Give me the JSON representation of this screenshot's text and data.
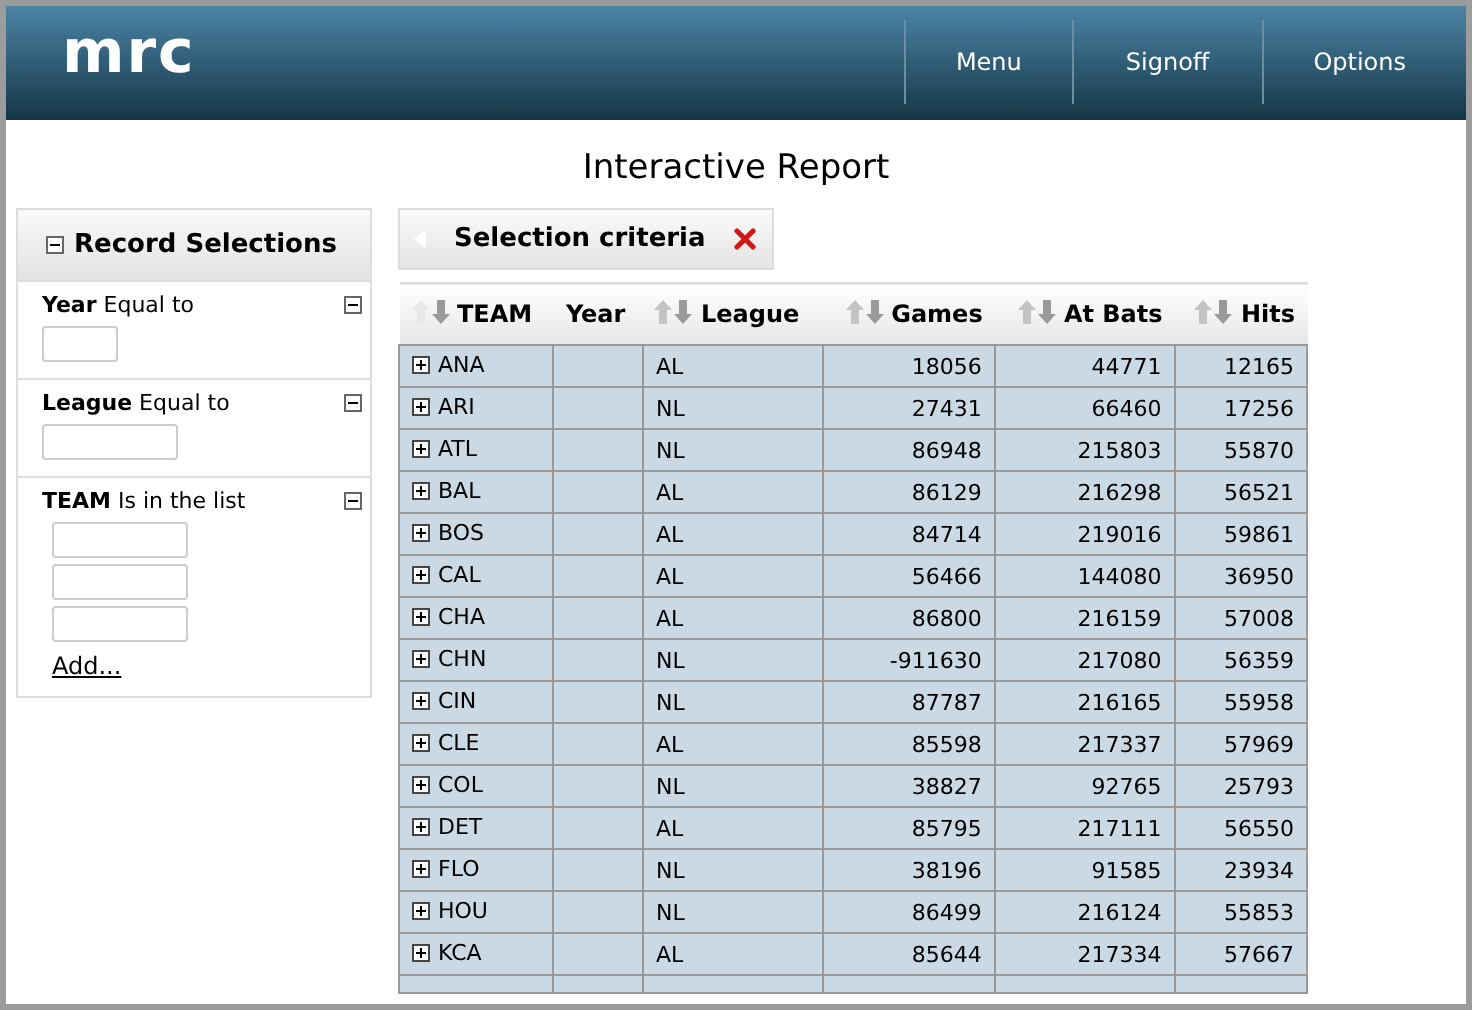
{
  "header": {
    "logo": "mrc",
    "nav": [
      "Menu",
      "Signoff",
      "Options"
    ]
  },
  "page_title": "Interactive Report",
  "sidebar": {
    "title": "Record Selections",
    "filters": [
      {
        "kind": "single",
        "field": "Year",
        "operator": "Equal to"
      },
      {
        "kind": "single",
        "field": "League",
        "operator": "Equal to"
      },
      {
        "kind": "list",
        "field": "TEAM",
        "operator": "Is in the list",
        "add_link": "Add..."
      }
    ]
  },
  "criteria": {
    "label": "Selection criteria"
  },
  "table": {
    "columns": [
      {
        "label": "TEAM",
        "sortable": true
      },
      {
        "label": "Year",
        "sortable": false
      },
      {
        "label": "League",
        "sortable": true
      },
      {
        "label": "Games",
        "sortable": true
      },
      {
        "label": "At Bats",
        "sortable": true
      },
      {
        "label": "Hits",
        "sortable": true
      }
    ],
    "rows": [
      [
        "ANA",
        "",
        "AL",
        "18056",
        "44771",
        "12165"
      ],
      [
        "ARI",
        "",
        "NL",
        "27431",
        "66460",
        "17256"
      ],
      [
        "ATL",
        "",
        "NL",
        "86948",
        "215803",
        "55870"
      ],
      [
        "BAL",
        "",
        "AL",
        "86129",
        "216298",
        "56521"
      ],
      [
        "BOS",
        "",
        "AL",
        "84714",
        "219016",
        "59861"
      ],
      [
        "CAL",
        "",
        "AL",
        "56466",
        "144080",
        "36950"
      ],
      [
        "CHA",
        "",
        "AL",
        "86800",
        "216159",
        "57008"
      ],
      [
        "CHN",
        "",
        "NL",
        "-911630",
        "217080",
        "56359"
      ],
      [
        "CIN",
        "",
        "NL",
        "87787",
        "216165",
        "55958"
      ],
      [
        "CLE",
        "",
        "AL",
        "85598",
        "217337",
        "57969"
      ],
      [
        "COL",
        "",
        "NL",
        "38827",
        "92765",
        "25793"
      ],
      [
        "DET",
        "",
        "AL",
        "85795",
        "217111",
        "56550"
      ],
      [
        "FLO",
        "",
        "NL",
        "38196",
        "91585",
        "23934"
      ],
      [
        "HOU",
        "",
        "NL",
        "86499",
        "216124",
        "55853"
      ],
      [
        "KCA",
        "",
        "AL",
        "85644",
        "217334",
        "57667"
      ]
    ]
  }
}
